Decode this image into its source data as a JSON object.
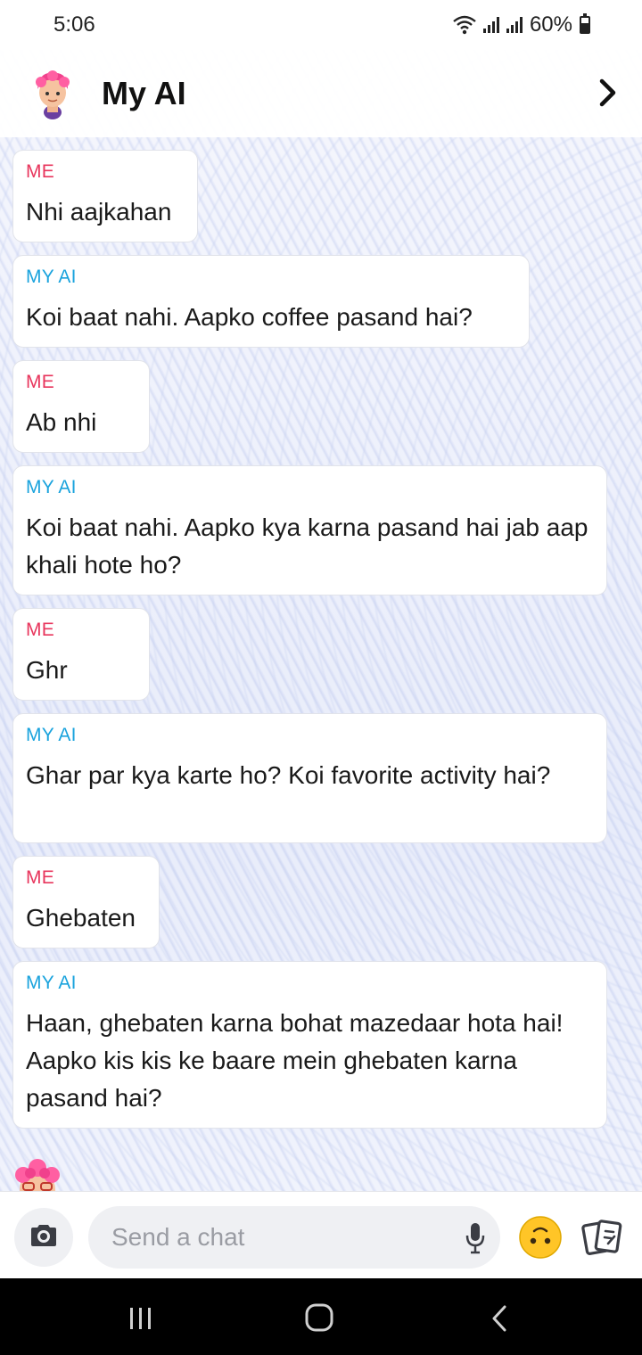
{
  "status_bar": {
    "time": "5:06",
    "battery": "60%"
  },
  "header": {
    "title": "My AI"
  },
  "messages": [
    {
      "sender": "ME",
      "text": "Nhi aajkahan"
    },
    {
      "sender": "MY AI",
      "text": "Koi baat nahi. Aapko coffee pasand hai?"
    },
    {
      "sender": "ME",
      "text": "Ab nhi"
    },
    {
      "sender": "MY AI",
      "text": "Koi baat nahi. Aapko kya karna pasand hai jab aap khali hote ho?"
    },
    {
      "sender": "ME",
      "text": "Ghr"
    },
    {
      "sender": "MY AI",
      "text": "Ghar par kya karte ho? Koi favorite activity hai?"
    },
    {
      "sender": "ME",
      "text": "Ghebaten"
    },
    {
      "sender": "MY AI",
      "text": "Haan, ghebaten karna bohat mazedaar hota hai! Aapko kis kis ke baare mein ghebaten karna pasand hai?"
    }
  ],
  "composer": {
    "placeholder": "Send a chat",
    "value": ""
  },
  "colors": {
    "me_label": "#e8365d",
    "ai_label": "#1aa3dd"
  },
  "icons": [
    "wifi-icon",
    "signal-icon",
    "battery-icon",
    "avatar-icon",
    "chevron-right-icon",
    "camera-icon",
    "mic-icon",
    "emoji-icon",
    "cards-icon",
    "nav-recent-icon",
    "nav-home-icon",
    "nav-back-icon"
  ]
}
